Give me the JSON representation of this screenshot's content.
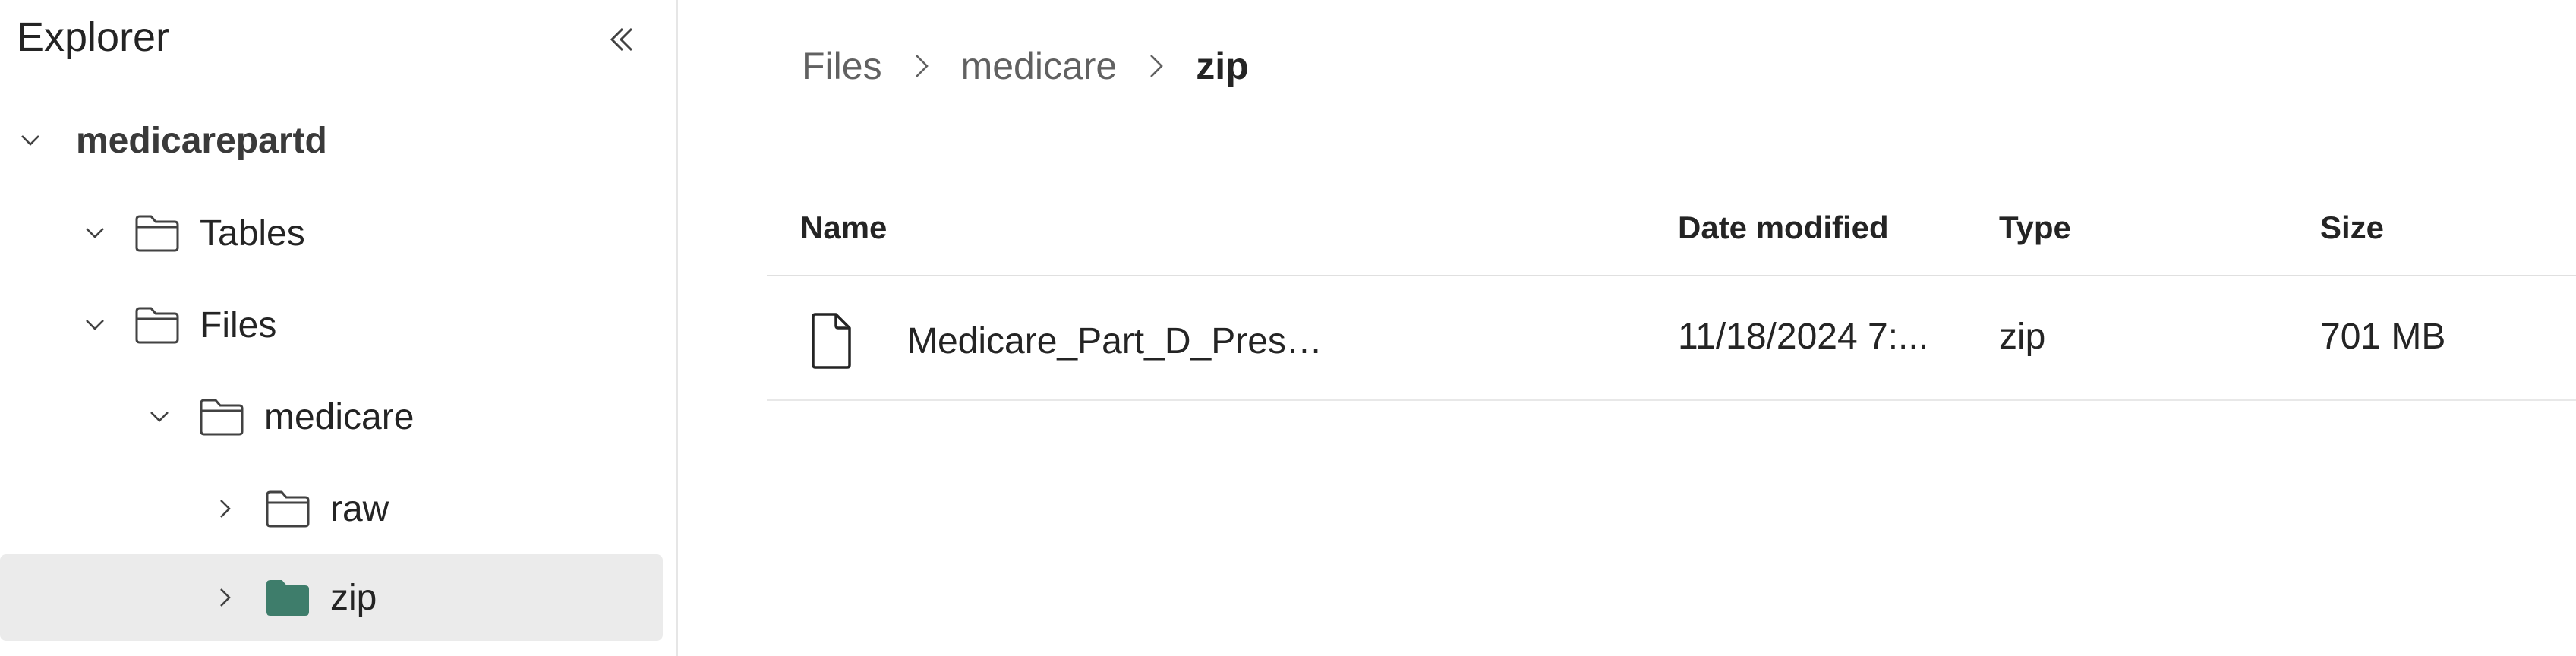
{
  "sidebar": {
    "title": "Explorer",
    "tree": [
      {
        "label": "medicarepartd",
        "expanded": true,
        "icon": "chevron-down-icon"
      },
      {
        "label": "Tables",
        "expanded": true,
        "icon": "folder-icon"
      },
      {
        "label": "Files",
        "expanded": true,
        "icon": "folder-icon"
      },
      {
        "label": "medicare",
        "expanded": true,
        "icon": "folder-icon"
      },
      {
        "label": "raw",
        "expanded": false,
        "icon": "folder-icon"
      },
      {
        "label": "zip",
        "expanded": false,
        "selected": true,
        "icon": "folder-filled-icon"
      }
    ]
  },
  "breadcrumb": [
    "Files",
    "medicare",
    "zip"
  ],
  "table": {
    "columns": [
      "Name",
      "Date modified",
      "Type",
      "Size"
    ],
    "rows": [
      {
        "name": "Medicare_Part_D_Prescribers_by_Provider_and...",
        "date_modified": "11/18/2024 7:...",
        "type": "zip",
        "size": "701 MB"
      }
    ]
  },
  "colors": {
    "selected_folder": "#3e7d6b",
    "selected_bg": "#ebebeb"
  }
}
